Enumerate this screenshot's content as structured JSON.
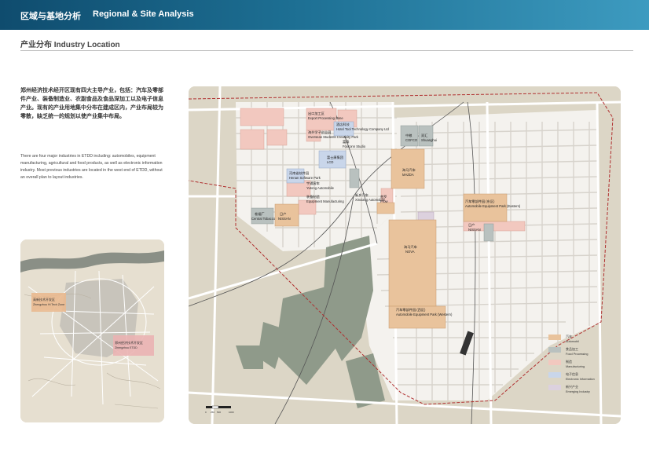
{
  "header": {
    "title_cn": "区域与基地分析",
    "title_en": "Regional & Site Analysis"
  },
  "section": {
    "title": "产业分布  Industry Location"
  },
  "intro": {
    "text_cn": "郑州经济技术经开区现有四大主导产业，包括：汽车及零部件产业、装备制造业、农副食品及食品深加工以及电子信息产业。现有的产业用地集中分布在建成区内，产业布局较为零散，缺乏统一的规划以使产业集中布局。",
    "text_en": "There are four major industries in ETDD including: automobiles, equipment manufacturing, agricultural and food products, as well as electronic information industry. Most previous industries are located in the west end of ETDD, without an overall plan to layout industries."
  },
  "minimap": {
    "label_hightech": {
      "cn": "高新技术开发区",
      "en": "Zhengzhou Hi Tech Zone"
    },
    "label_etdd": {
      "cn": "郑州经济技术开发区",
      "en": "Zhengzhou ETDD"
    }
  },
  "map_labels": {
    "export_zone": {
      "cn": "出口加工区",
      "en": "Export Processing Zone"
    },
    "overseas_park": {
      "cn": "海外学子创业园",
      "en": "Overseas Students Creativity Park"
    },
    "hotel": {
      "cn": "酒店科技",
      "en": "Hotel Tool Technology Company Ltd"
    },
    "foxconn": {
      "cn": "富泰",
      "en": "Foxconn Studio"
    },
    "cofco": {
      "cn": "中粮",
      "en": "COFCO"
    },
    "shuanghui": {
      "cn": "双汇",
      "en": "Shuanghui"
    },
    "lcd": {
      "cn": "富士康集团",
      "en": "LCD"
    },
    "software": {
      "cn": "河南省软件园",
      "en": "Henan Software Park"
    },
    "yutong": {
      "cn": "宇通客车",
      "en": "Yutong Automobile"
    },
    "equipment_park": {
      "cn": "装备制造",
      "en": "Equipment Manufacturing"
    },
    "xinxiang": {
      "cn": "新乡汽车",
      "en": "Xinxiang Automobile"
    },
    "prow": {
      "cn": "普罗",
      "en": "Prow"
    },
    "mazda": {
      "cn": "海马汽车",
      "en": "MAZDA"
    },
    "tobacco": {
      "cn": "卷烟厂",
      "en": "Central Tobacco"
    },
    "nissan_west": {
      "cn": "日产",
      "en": "NISSAN"
    },
    "auto_east": {
      "cn": "汽车零部件园 (东区)",
      "en": "Automobile Equipment Park (Eastern)"
    },
    "nissan_east": {
      "cn": "日产",
      "en": "NISSAN"
    },
    "nova": {
      "cn": "海马汽车",
      "en": "NOVA"
    },
    "auto_west": {
      "cn": "汽车零部件园 (西区)",
      "en": "Automobile Equipment Park (Western)"
    }
  },
  "legend": [
    {
      "cn": "汽车",
      "en": "Automobil",
      "color": "#e9c39c"
    },
    {
      "cn": "食品加工",
      "en": "Food Processing",
      "color": "#b9c1bf"
    },
    {
      "cn": "制造",
      "en": "Manufacturing",
      "color": "#f2c8bf"
    },
    {
      "cn": "电子信息",
      "en": "Electronic Information",
      "color": "#c9d6ea"
    },
    {
      "cn": "新兴产业",
      "en": "Emerging Industry",
      "color": "#dcd1de"
    }
  ],
  "scale": {
    "labels": [
      "0",
      "250",
      "500",
      "1000"
    ]
  },
  "colors": {
    "header_dark": "#0f4c6e",
    "auto": "#e9c39c",
    "food": "#b9c1bf",
    "manufacturing": "#f2c8bf",
    "electronic": "#c9d6ea",
    "emerging": "#dcd1de",
    "green": "#8f9a8a",
    "boundary": "#b03030"
  }
}
